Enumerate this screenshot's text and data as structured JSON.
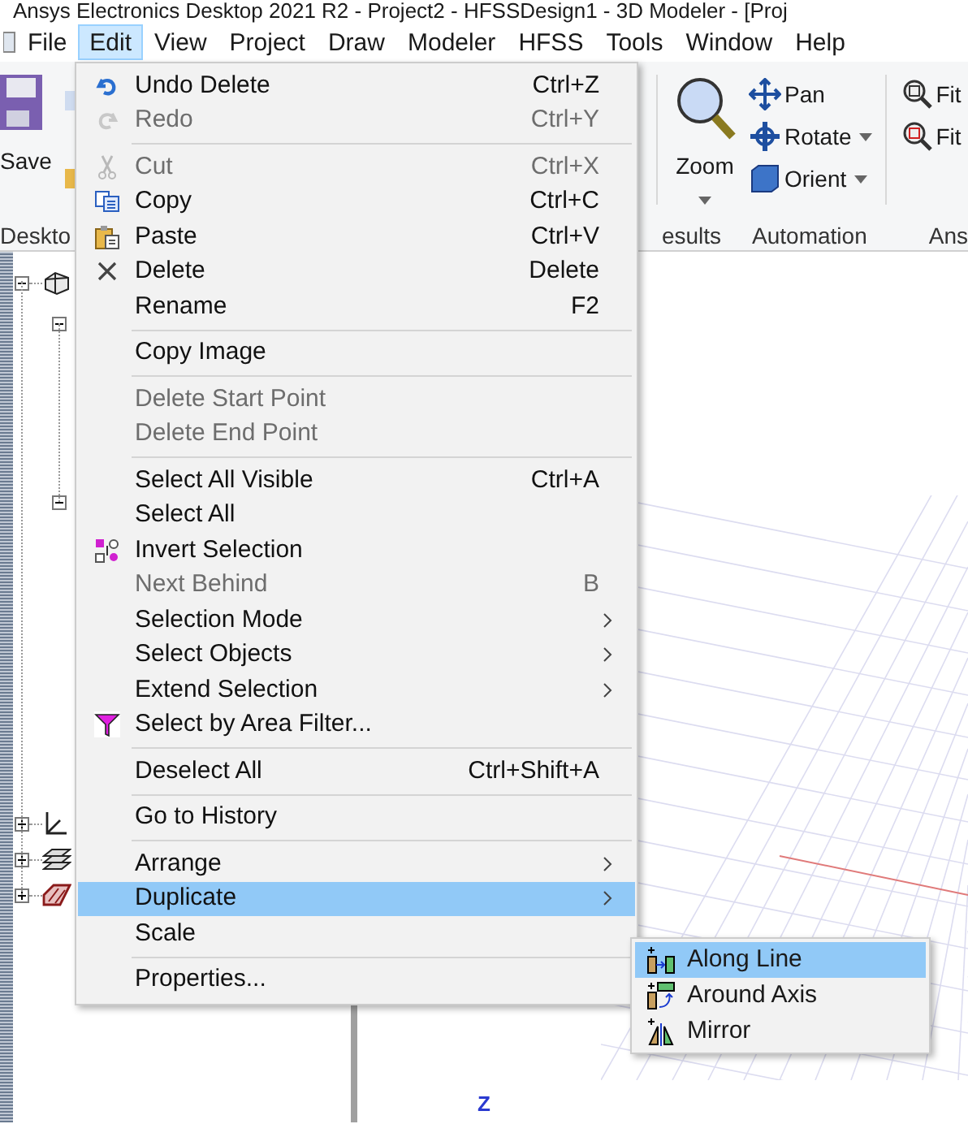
{
  "window": {
    "title": "Ansys Electronics Desktop 2021 R2 - Project2 - HFSSDesign1 - 3D Modeler - [Proj"
  },
  "menubar": [
    {
      "label": "File",
      "selected": false
    },
    {
      "label": "Edit",
      "selected": true
    },
    {
      "label": "View",
      "selected": false
    },
    {
      "label": "Project",
      "selected": false
    },
    {
      "label": "Draw",
      "selected": false
    },
    {
      "label": "Modeler",
      "selected": false
    },
    {
      "label": "HFSS",
      "selected": false
    },
    {
      "label": "Tools",
      "selected": false
    },
    {
      "label": "Window",
      "selected": false
    },
    {
      "label": "Help",
      "selected": false
    }
  ],
  "ribbon": {
    "save": "Save",
    "zoom": "Zoom",
    "pan": "Pan",
    "rotate": "Rotate",
    "orient": "Orient",
    "fit": [
      "Fit",
      "Fit"
    ],
    "groups": [
      "Deskto",
      "esults",
      "Automation",
      "Ans"
    ]
  },
  "tree": [
    {
      "expanded": true,
      "children": [
        {
          "expanded": true
        },
        {
          "expanded": true
        }
      ]
    },
    {
      "expanded": false
    },
    {
      "expanded": false
    },
    {
      "expanded": false
    }
  ],
  "viewport": {
    "axis_label": "Z"
  },
  "edit_menu": [
    [
      {
        "label": "Undo Delete",
        "shortcut": "Ctrl+Z",
        "disabled": false,
        "submenu": false,
        "selected": false
      },
      {
        "label": "Redo",
        "shortcut": "Ctrl+Y",
        "disabled": true,
        "submenu": false,
        "selected": false
      }
    ],
    [
      {
        "label": "Cut",
        "shortcut": "Ctrl+X",
        "disabled": true,
        "submenu": false,
        "selected": false
      },
      {
        "label": "Copy",
        "shortcut": "Ctrl+C",
        "disabled": false,
        "submenu": false,
        "selected": false
      },
      {
        "label": "Paste",
        "shortcut": "Ctrl+V",
        "disabled": false,
        "submenu": false,
        "selected": false
      },
      {
        "label": "Delete",
        "shortcut": "Delete",
        "disabled": false,
        "submenu": false,
        "selected": false
      },
      {
        "label": "Rename",
        "shortcut": "F2",
        "disabled": false,
        "submenu": false,
        "selected": false
      }
    ],
    [
      {
        "label": "Copy Image",
        "disabled": false,
        "submenu": false,
        "selected": false
      }
    ],
    [
      {
        "label": "Delete Start Point",
        "disabled": true,
        "submenu": false,
        "selected": false
      },
      {
        "label": "Delete End Point",
        "disabled": true,
        "submenu": false,
        "selected": false
      }
    ],
    [
      {
        "label": "Select All Visible",
        "shortcut": "Ctrl+A",
        "disabled": false,
        "submenu": false,
        "selected": false
      },
      {
        "label": "Select All",
        "disabled": false,
        "submenu": false,
        "selected": false
      },
      {
        "label": "Invert Selection",
        "disabled": false,
        "submenu": false,
        "selected": false
      },
      {
        "label": "Next Behind",
        "shortcut": "B",
        "disabled": true,
        "submenu": false,
        "selected": false
      },
      {
        "label": "Selection Mode",
        "disabled": false,
        "submenu": true,
        "selected": false
      },
      {
        "label": "Select Objects",
        "disabled": false,
        "submenu": true,
        "selected": false
      },
      {
        "label": "Extend Selection",
        "disabled": false,
        "submenu": true,
        "selected": false
      },
      {
        "label": "Select by Area Filter...",
        "disabled": false,
        "submenu": false,
        "selected": false
      }
    ],
    [
      {
        "label": "Deselect All",
        "shortcut": "Ctrl+Shift+A",
        "disabled": false,
        "submenu": false,
        "selected": false
      }
    ],
    [
      {
        "label": "Go to History",
        "disabled": false,
        "submenu": false,
        "selected": false
      }
    ],
    [
      {
        "label": "Arrange",
        "disabled": false,
        "submenu": true,
        "selected": false
      },
      {
        "label": "Duplicate",
        "disabled": false,
        "submenu": true,
        "selected": true
      },
      {
        "label": "Scale",
        "disabled": false,
        "submenu": false,
        "selected": false
      }
    ],
    [
      {
        "label": "Properties...",
        "disabled": false,
        "submenu": false,
        "selected": false
      }
    ]
  ],
  "duplicate_submenu": [
    {
      "label": "Along Line",
      "selected": true
    },
    {
      "label": "Around Axis",
      "selected": false
    },
    {
      "label": "Mirror",
      "selected": false
    }
  ]
}
